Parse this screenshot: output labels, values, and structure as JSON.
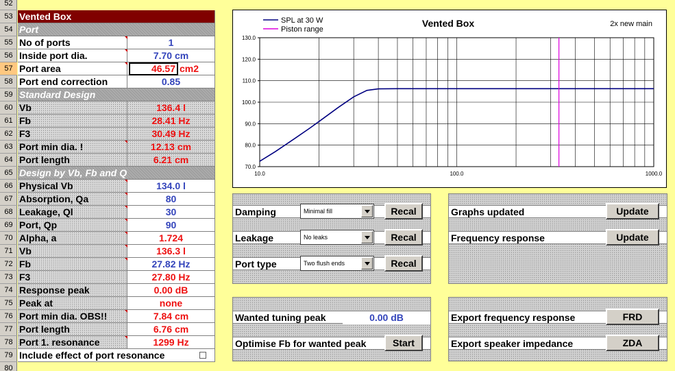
{
  "row_numbers": [
    "52",
    "53",
    "54",
    "55",
    "56",
    "57",
    "58",
    "59",
    "60",
    "61",
    "62",
    "63",
    "64",
    "65",
    "66",
    "67",
    "68",
    "69",
    "70",
    "71",
    "72",
    "73",
    "74",
    "75",
    "76",
    "77",
    "78",
    "79",
    "80"
  ],
  "selected_row": "57",
  "title": "Vented Box",
  "port": {
    "header": "Port",
    "no_of_ports_label": "No of ports",
    "no_of_ports": "1",
    "inside_dia_label": "Inside port dia.",
    "inside_dia": "7.70 cm",
    "port_area_label": "Port area",
    "port_area": "46.57",
    "port_area_unit": "cm2",
    "end_corr_label": "Port end correction",
    "end_corr": "0.85"
  },
  "standard": {
    "header": "Standard Design",
    "vb_label": "Vb",
    "vb": "136.4 l",
    "fb_label": "Fb",
    "fb": "28.41 Hz",
    "f3_label": "F3",
    "f3": "30.49 Hz",
    "min_dia_label": "Port min dia. !",
    "min_dia": "12.13 cm",
    "length_label": "Port length",
    "length": "6.21 cm"
  },
  "design": {
    "header": "Design by Vb, Fb and Q",
    "phys_vb_label": "Physical Vb",
    "phys_vb": "134.0 l",
    "qa_label": "Absorption, Qa",
    "qa": "80",
    "ql_label": "Leakage, Ql",
    "ql": "30",
    "qp_label": "Port, Qp",
    "qp": "90",
    "alpha_label": "Alpha, a",
    "alpha": "1.724",
    "vb_label": "Vb",
    "vb": "136.3 l",
    "fb_label": "Fb",
    "fb": "27.82 Hz",
    "f3_label": "F3",
    "f3": "27.80 Hz",
    "peak_label": "Response peak",
    "peak": "0.00 dB",
    "peak_at_label": "Peak at",
    "peak_at": "none",
    "min_dia_label": "Port min dia. OBS!!",
    "min_dia": "7.84 cm",
    "length_label": "Port length",
    "length": "6.76 cm",
    "reson_label": "Port 1. resonance",
    "reson": "1299 Hz",
    "include_label": "Include effect of port resonance"
  },
  "chart_data": {
    "type": "line",
    "title": "Vented Box",
    "subtitle": "2x new main",
    "xscale": "log",
    "xlim": [
      10,
      1000
    ],
    "ylim": [
      70,
      130
    ],
    "x_ticks": [
      "10.0",
      "100.0",
      "1000.0"
    ],
    "y_ticks": [
      "130.0",
      "120.0",
      "110.0",
      "100.0",
      "90.0",
      "80.0",
      "70.0"
    ],
    "grid": true,
    "legend_position": "top-left",
    "series": [
      {
        "name": "SPL at 30 W",
        "color": "#000080",
        "x": [
          10,
          12,
          15,
          18,
          20,
          25,
          30,
          35,
          40,
          50,
          100,
          1000
        ],
        "y": [
          72.5,
          77,
          83,
          88,
          91,
          97.5,
          102.5,
          105.5,
          106.2,
          106.3,
          106.3,
          106.3
        ]
      },
      {
        "name": "Piston range",
        "color": "#dd00dd",
        "x": [
          330,
          330
        ],
        "y": [
          70,
          130
        ]
      }
    ]
  },
  "controls": {
    "damping_label": "Damping",
    "damping_value": "Minimal fill",
    "leakage_label": "Leakage",
    "leakage_value": "No leaks",
    "port_type_label": "Port type",
    "port_type_value": "Two flush ends",
    "recal": "Recal",
    "graphs_label": "Graphs updated",
    "freq_label": "Frequency response",
    "update": "Update",
    "wanted_label": "Wanted tuning peak",
    "wanted_value": "0.00 dB",
    "optimise_label": "Optimise Fb for wanted peak",
    "start": "Start",
    "export_freq_label": "Export frequency response",
    "frd": "FRD",
    "export_imp_label": "Export speaker impedance",
    "zda": "ZDA"
  }
}
